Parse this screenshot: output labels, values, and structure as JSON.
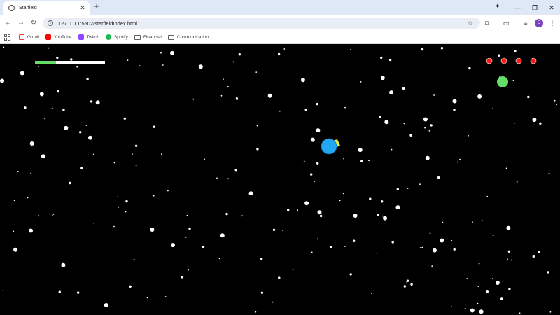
{
  "browser": {
    "tab_title": "Starfield",
    "tab_close": "✕",
    "new_tab": "+",
    "url": "127.0.0.1:5502/starfieldIndex.html",
    "profile_initial": "D",
    "bookmarks": [
      {
        "label": "Gmail",
        "icon": "gmail-icon",
        "color": "#ea4335"
      },
      {
        "label": "YouTube",
        "icon": "youtube-icon",
        "color": "#ff0000"
      },
      {
        "label": "Twitch",
        "icon": "twitch-icon",
        "color": "#9146ff"
      },
      {
        "label": "Spotify",
        "icon": "spotify-icon",
        "color": "#1db954"
      },
      {
        "label": "Financial",
        "icon": "folder-icon",
        "color": "#5f6368"
      },
      {
        "label": "Communication",
        "icon": "folder-icon",
        "color": "#5f6368"
      }
    ]
  },
  "game": {
    "background": "#000000",
    "health": {
      "fraction": 0.3,
      "fill_color": "#66dd66",
      "track_color": "#ffffff"
    },
    "lives": {
      "count": 4,
      "color": "#ff1a1a"
    },
    "powerup_color": "#66dd66",
    "player": {
      "body_color": "#22a8f0",
      "gun_color": "#e8ec3a"
    }
  }
}
